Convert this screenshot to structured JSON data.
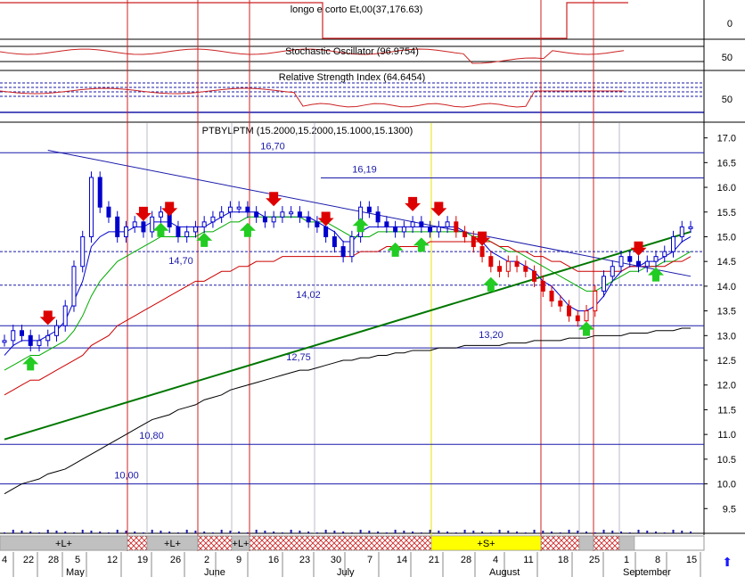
{
  "panels": {
    "top_title": "longo e corto Et,00(37,176.63)",
    "stoch_title": "Stochastic Oscillator (96.9754)",
    "rsi_title": "Relative Strength Index (64.6454)",
    "main_title": "PTBYLPTM (15.2000,15.2000,15.1000,15.1300)",
    "top_axis": [
      "0"
    ],
    "stoch_axis": [
      "50"
    ],
    "rsi_axis": [
      "50"
    ]
  },
  "chart_data": {
    "type": "candlestick",
    "title": "PTBYLPTM (15.2000,15.2000,15.1000,15.1300)",
    "ylim": [
      9.0,
      17.3
    ],
    "y_ticks": [
      9.5,
      10.0,
      10.5,
      11.0,
      11.5,
      12.0,
      12.5,
      13.0,
      13.5,
      14.0,
      14.5,
      15.0,
      15.5,
      16.0,
      16.5,
      17.0
    ],
    "x_tick_labels": [
      "4",
      "22",
      "28",
      "5",
      "12",
      "19",
      "26",
      "2",
      "9",
      "16",
      "23",
      "30",
      "7",
      "14",
      "21",
      "28",
      "4",
      "11",
      "18",
      "25",
      "1",
      "8",
      "15"
    ],
    "month_labels": [
      "May",
      "June",
      "July",
      "August",
      "September"
    ],
    "horizontal_levels": [
      16.7,
      16.19,
      14.7,
      14.02,
      13.2,
      12.75,
      10.8,
      10.0
    ],
    "level_labels": [
      "16,70",
      "16,19",
      "14,70",
      "14,02",
      "13,20",
      "12,75",
      "10,80",
      "10,00"
    ],
    "period_labels": [
      "+L+",
      "+L+",
      "+L+",
      "+S+"
    ],
    "close_series": [
      12.9,
      13.1,
      13.0,
      12.8,
      12.9,
      13.0,
      13.2,
      13.6,
      14.4,
      15.0,
      16.2,
      15.6,
      15.4,
      15.0,
      15.2,
      15.3,
      15.1,
      15.4,
      15.5,
      15.2,
      15.0,
      15.1,
      15.2,
      15.3,
      15.4,
      15.5,
      15.6,
      15.6,
      15.5,
      15.4,
      15.3,
      15.4,
      15.5,
      15.5,
      15.4,
      15.3,
      15.2,
      15.0,
      14.8,
      14.6,
      15.0,
      15.6,
      15.5,
      15.3,
      15.2,
      15.1,
      15.2,
      15.3,
      15.2,
      15.1,
      15.2,
      15.3,
      15.1,
      15.0,
      14.8,
      14.6,
      14.4,
      14.3,
      14.5,
      14.4,
      14.3,
      14.1,
      13.9,
      13.7,
      13.6,
      13.4,
      13.3,
      13.5,
      13.9,
      14.2,
      14.4,
      14.6,
      14.5,
      14.4,
      14.5,
      14.6,
      14.7,
      15.0,
      15.2,
      15.2
    ],
    "series": [
      {
        "name": "MA short",
        "color": "#0000cc",
        "values": [
          12.6,
          12.8,
          12.9,
          12.9,
          12.9,
          13.0,
          13.1,
          13.3,
          13.7,
          14.1,
          14.8,
          15.0,
          15.1,
          15.1,
          15.1,
          15.2,
          15.2,
          15.3,
          15.3,
          15.3,
          15.2,
          15.2,
          15.2,
          15.2,
          15.3,
          15.4,
          15.5,
          15.5,
          15.5,
          15.5,
          15.4,
          15.4,
          15.4,
          15.4,
          15.4,
          15.4,
          15.3,
          15.2,
          15.1,
          14.9,
          14.9,
          15.1,
          15.2,
          15.2,
          15.2,
          15.2,
          15.2,
          15.2,
          15.2,
          15.2,
          15.2,
          15.2,
          15.2,
          15.1,
          15.0,
          14.9,
          14.7,
          14.6,
          14.5,
          14.5,
          14.4,
          14.3,
          14.1,
          14.0,
          13.8,
          13.6,
          13.5,
          13.5,
          13.6,
          13.8,
          14.1,
          14.3,
          14.4,
          14.4,
          14.5,
          14.5,
          14.6,
          14.7,
          14.9,
          15.0
        ]
      },
      {
        "name": "MA medium",
        "color": "#00aa00",
        "values": [
          12.3,
          12.4,
          12.5,
          12.6,
          12.6,
          12.7,
          12.8,
          12.9,
          13.1,
          13.4,
          13.8,
          14.1,
          14.3,
          14.5,
          14.6,
          14.7,
          14.8,
          14.9,
          15.0,
          15.0,
          15.0,
          15.0,
          15.0,
          15.1,
          15.1,
          15.2,
          15.3,
          15.3,
          15.4,
          15.4,
          15.4,
          15.4,
          15.4,
          15.4,
          15.4,
          15.3,
          15.3,
          15.3,
          15.2,
          15.1,
          15.0,
          15.0,
          15.0,
          15.1,
          15.1,
          15.1,
          15.1,
          15.1,
          15.1,
          15.1,
          15.1,
          15.1,
          15.1,
          15.1,
          15.0,
          15.0,
          14.9,
          14.8,
          14.7,
          14.7,
          14.6,
          14.5,
          14.4,
          14.3,
          14.2,
          14.1,
          14.0,
          13.9,
          13.9,
          14.0,
          14.1,
          14.2,
          14.3,
          14.3,
          14.4,
          14.4,
          14.5,
          14.5,
          14.6,
          14.7
        ]
      },
      {
        "name": "MA long",
        "color": "#cc0000",
        "values": [
          11.8,
          11.9,
          12.0,
          12.1,
          12.1,
          12.2,
          12.3,
          12.4,
          12.5,
          12.6,
          12.8,
          12.9,
          13.0,
          13.2,
          13.3,
          13.4,
          13.5,
          13.6,
          13.7,
          13.8,
          13.9,
          14.0,
          14.1,
          14.1,
          14.2,
          14.3,
          14.3,
          14.4,
          14.4,
          14.5,
          14.5,
          14.5,
          14.6,
          14.6,
          14.6,
          14.6,
          14.6,
          14.6,
          14.6,
          14.6,
          14.6,
          14.7,
          14.7,
          14.7,
          14.8,
          14.8,
          14.8,
          14.8,
          14.8,
          14.9,
          14.9,
          14.9,
          14.9,
          14.9,
          14.9,
          14.9,
          14.9,
          14.8,
          14.8,
          14.7,
          14.7,
          14.6,
          14.6,
          14.5,
          14.5,
          14.4,
          14.3,
          14.3,
          14.3,
          14.3,
          14.3,
          14.3,
          14.4,
          14.4,
          14.4,
          14.4,
          14.4,
          14.5,
          14.5,
          14.6
        ]
      },
      {
        "name": "MA 200",
        "color": "#000000",
        "values": [
          9.8,
          9.9,
          10.0,
          10.05,
          10.1,
          10.2,
          10.25,
          10.3,
          10.4,
          10.5,
          10.6,
          10.7,
          10.8,
          10.9,
          11.0,
          11.1,
          11.2,
          11.3,
          11.35,
          11.4,
          11.5,
          11.55,
          11.6,
          11.7,
          11.75,
          11.8,
          11.9,
          11.95,
          12.0,
          12.05,
          12.1,
          12.15,
          12.2,
          12.25,
          12.3,
          12.3,
          12.35,
          12.4,
          12.45,
          12.5,
          12.5,
          12.55,
          12.55,
          12.6,
          12.6,
          12.65,
          12.65,
          12.7,
          12.7,
          12.7,
          12.75,
          12.75,
          12.75,
          12.8,
          12.8,
          12.8,
          12.8,
          12.8,
          12.85,
          12.85,
          12.85,
          12.9,
          12.9,
          12.9,
          12.9,
          12.95,
          12.95,
          12.95,
          13.0,
          13.0,
          13.0,
          13.0,
          13.05,
          13.05,
          13.05,
          13.1,
          13.1,
          13.1,
          13.15,
          13.15
        ]
      }
    ],
    "trendlines": [
      {
        "name": "resistance",
        "color": "#1a1aaa",
        "from": [
          5,
          16.75
        ],
        "to": [
          120,
          14.2
        ]
      },
      {
        "name": "support",
        "color": "#007700",
        "from": [
          0,
          10.9
        ],
        "to": [
          120,
          15.1
        ]
      }
    ]
  }
}
